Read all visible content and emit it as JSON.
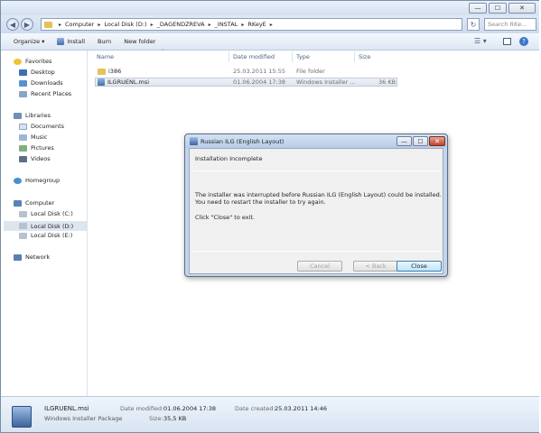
{
  "window": {
    "minimize_glyph": "—",
    "maximize_glyph": "☐",
    "close_glyph": "✕"
  },
  "address": {
    "back_glyph": "◀",
    "forward_glyph": "▶",
    "crumbs": [
      "Computer",
      "Local Disk (D:)",
      "_DAGENDZREVA",
      "_INSTAL",
      "RKeyE"
    ],
    "search_placeholder": "Search RKe..."
  },
  "toolbar": {
    "organize": "Organize ▾",
    "install": "Install",
    "burn": "Burn",
    "new_folder": "New folder"
  },
  "nav": {
    "favorites": "Favorites",
    "desktop": "Desktop",
    "downloads": "Downloads",
    "recent": "Recent Places",
    "libraries": "Libraries",
    "documents": "Documents",
    "music": "Music",
    "pictures": "Pictures",
    "videos": "Videos",
    "homegroup": "Homegroup",
    "computer": "Computer",
    "disk_c": "Local Disk (C:)",
    "disk_d": "Local Disk (D:)",
    "disk_e": "Local Disk (E:)",
    "network": "Network"
  },
  "columns": {
    "name": "Name",
    "date": "Date modified",
    "type": "Type",
    "size": "Size"
  },
  "files": [
    {
      "name": "i386",
      "date": "25.03.2011 15:55",
      "type": "File folder",
      "size": ""
    },
    {
      "name": "ILGRUENL.msi",
      "date": "01.06.2004 17:38",
      "type": "Windows Installer ...",
      "size": "36 KB"
    }
  ],
  "details": {
    "name": "ILGRUENL.msi",
    "kind": "Windows Installer Package",
    "date_modified_label": "Date modified:",
    "date_modified": "01.06.2004 17:38",
    "size_label": "Size:",
    "size": "35,5 KB",
    "date_created_label": "Date created:",
    "date_created": "25.03.2011 14:46"
  },
  "dialog": {
    "title": "Russian ILG (English Layout)",
    "heading": "Installation Incomplete",
    "line1": "The installer was interrupted before Russian ILG (English Layout) could be installed.",
    "line2": "You need to restart the installer to try again.",
    "line3": "Click \"Close\" to exit.",
    "cancel": "Cancel",
    "back": "< Back",
    "close": "Close"
  },
  "colors": {
    "accent": "#3c7fb1",
    "folder": "#e7c15a",
    "selection": "#dde5ef"
  }
}
